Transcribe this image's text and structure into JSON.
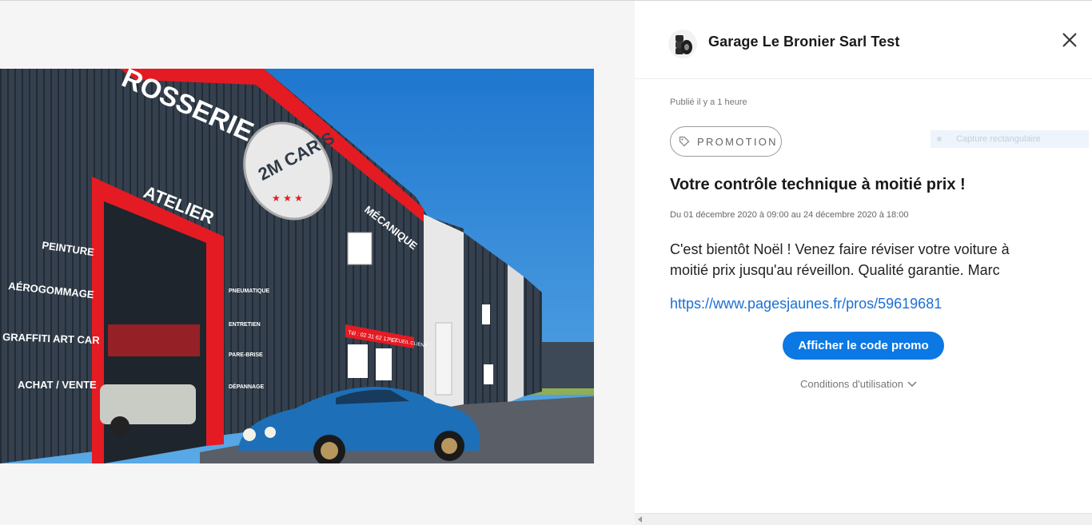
{
  "photo": {
    "signs": {
      "carrosserie": "ROSSERIE",
      "brand": "2M CAR'S",
      "atelier": "ATELIER",
      "mecanique": "MÉCANIQUE",
      "services": [
        "PEINTURE",
        "AÉROGOMMAGE",
        "GRAFFITI ART CAR",
        "ACHAT / VENTE"
      ],
      "door_services": [
        "PNEUMATIQUE",
        "ENTRETIEN",
        "PARE-BRISE",
        "DÉPANNAGE"
      ],
      "phone": "Tél : 02 31 62 17 17",
      "reception": "ACCUEIL CLIENT"
    }
  },
  "header": {
    "business_name": "Garage Le Bronier Sarl Test",
    "logo_icon": "tires-icon",
    "close_icon": "close-icon"
  },
  "post": {
    "published": "Publié il y a 1 heure",
    "badge": "PROMOTION",
    "badge_icon": "tag-icon",
    "title": "Votre contrôle technique à moitié prix !",
    "dates": "Du 01 décembre 2020 à 09:00 au 24 décembre 2020 à 18:00",
    "description": "C'est bientôt Noël ! Venez faire réviser votre voiture à moitié prix jusqu'au réveillon. Qualité garantie. Marc",
    "link": "https://www.pagesjaunes.fr/pros/59619681",
    "cta": "Afficher le code promo",
    "conditions": "Conditions d'utilisation"
  },
  "overlay": {
    "capture_label": "Capture rectangulaire"
  },
  "colors": {
    "accent": "#0b78e3",
    "link": "#1b6fd6",
    "facade": "#2f3a47",
    "brand_red": "#e41b23",
    "sky": "#2a86d6"
  }
}
